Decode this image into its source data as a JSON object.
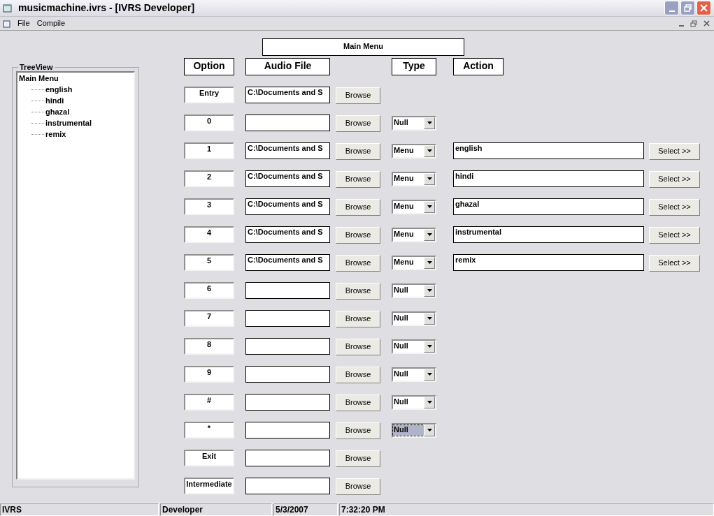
{
  "window": {
    "title": "musicmachine.ivrs - [IVRS Developer]"
  },
  "menu": [
    "File",
    "Compile"
  ],
  "menu_title": "Main Menu",
  "tree": {
    "label": "TreeView",
    "root": {
      "label": "Main Menu",
      "children": [
        {
          "label": "english"
        },
        {
          "label": "hindi"
        },
        {
          "label": "ghazal"
        },
        {
          "label": "instrumental"
        },
        {
          "label": "remix"
        }
      ]
    }
  },
  "columns": [
    "Option",
    "Audio File",
    "Type",
    "Action"
  ],
  "rows": [
    {
      "option": "Entry",
      "audio": "C:\\Documents and S",
      "browse": "Browse"
    },
    {
      "option": "0",
      "audio": "",
      "browse": "Browse",
      "type": "Null",
      "focused": false
    },
    {
      "option": "1",
      "audio": "C:\\Documents and S",
      "browse": "Browse",
      "type": "Menu",
      "focused": false,
      "action": "english",
      "select": "Select >>"
    },
    {
      "option": "2",
      "audio": "C:\\Documents and S",
      "browse": "Browse",
      "type": "Menu",
      "focused": false,
      "action": "hindi",
      "select": "Select >>"
    },
    {
      "option": "3",
      "audio": "C:\\Documents and S",
      "browse": "Browse",
      "type": "Menu",
      "focused": false,
      "action": "ghazal",
      "select": "Select >>"
    },
    {
      "option": "4",
      "audio": "C:\\Documents and S",
      "browse": "Browse",
      "type": "Menu",
      "focused": false,
      "action": "instrumental",
      "select": "Select >>"
    },
    {
      "option": "5",
      "audio": "C:\\Documents and S",
      "browse": "Browse",
      "type": "Menu",
      "focused": false,
      "action": "remix",
      "select": "Select >>"
    },
    {
      "option": "6",
      "audio": "",
      "browse": "Browse",
      "type": "Null",
      "focused": false
    },
    {
      "option": "7",
      "audio": "",
      "browse": "Browse",
      "type": "Null",
      "focused": false
    },
    {
      "option": "8",
      "audio": "",
      "browse": "Browse",
      "type": "Null",
      "focused": false
    },
    {
      "option": "9",
      "audio": "",
      "browse": "Browse",
      "type": "Null",
      "focused": false
    },
    {
      "option": "#",
      "audio": "",
      "browse": "Browse",
      "type": "Null",
      "focused": false
    },
    {
      "option": "*",
      "audio": "",
      "browse": "Browse",
      "type": "Null",
      "focused": true
    },
    {
      "option": "Exit",
      "audio": "",
      "browse": "Browse"
    },
    {
      "option": "Intermediate",
      "audio": "",
      "browse": "Browse"
    }
  ],
  "status_bar": [
    "IVRS",
    "Developer",
    "5/3/2007",
    "7:32:20 PM"
  ]
}
